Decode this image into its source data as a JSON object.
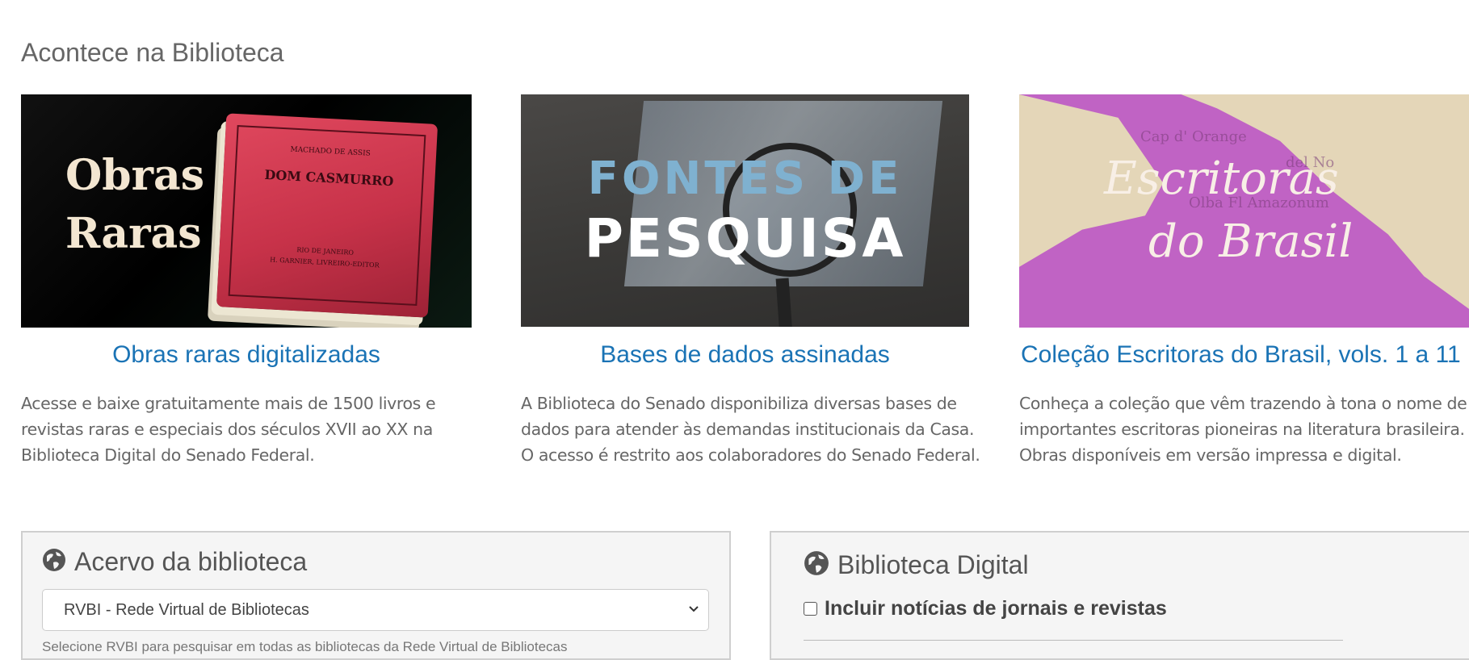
{
  "section": {
    "title": "Acontece na Biblioteca"
  },
  "cards": [
    {
      "image_words": [
        "Obras",
        "Raras"
      ],
      "book": {
        "author": "MACHADO DE ASSIS",
        "title": "DOM CASMURRO",
        "imprint_1": "RIO DE JANEIRO",
        "imprint_2": "H. GARNIER, LIVREIRO-EDITOR"
      },
      "title": "Obras raras digitalizadas",
      "lines": [
        "Acesse e baixe gratuitamente mais de 1500 livros e",
        "revistas raras e especiais dos séculos XVII ao XX na",
        "Biblioteca Digital do Senado Federal."
      ]
    },
    {
      "image_line_1": "FONTES DE",
      "image_line_2": "PESQUISA",
      "title": "Bases de dados assinadas",
      "lines": [
        "A Biblioteca do Senado disponibiliza diversas bases de",
        "dados para atender às demandas institucionais da Casa.",
        "O acesso é restrito aos colaboradores do Senado Federal."
      ]
    },
    {
      "image_line_1": "Escritoras",
      "image_line_2": "do Brasil",
      "map_labels": [
        "Cap d' Orange",
        "del No",
        "Olba Fl Amazonum"
      ],
      "title": "Coleção Escritoras do Brasil, vols. 1 a 11",
      "lines": [
        "Conheça a coleção que vêm trazendo à tona o nome de",
        "importantes escritoras pioneiras na literatura brasileira.",
        "Obras disponíveis em versão impressa e digital."
      ]
    }
  ],
  "panels": {
    "acervo": {
      "title": "Acervo da biblioteca",
      "icon": "globe-icon",
      "select_value": "RVBI - Rede Virtual de Bibliotecas",
      "hint": "Selecione RVBI para pesquisar em todas as bibliotecas da Rede Virtual de Bibliotecas"
    },
    "digital": {
      "title": "Biblioteca Digital",
      "icon": "globe-icon",
      "checkbox_label": "Incluir notícias de jornais e revistas"
    }
  },
  "colors": {
    "link": "#1a73b5",
    "panel_bg": "#f5f5f5",
    "purple": "#c063c4"
  }
}
